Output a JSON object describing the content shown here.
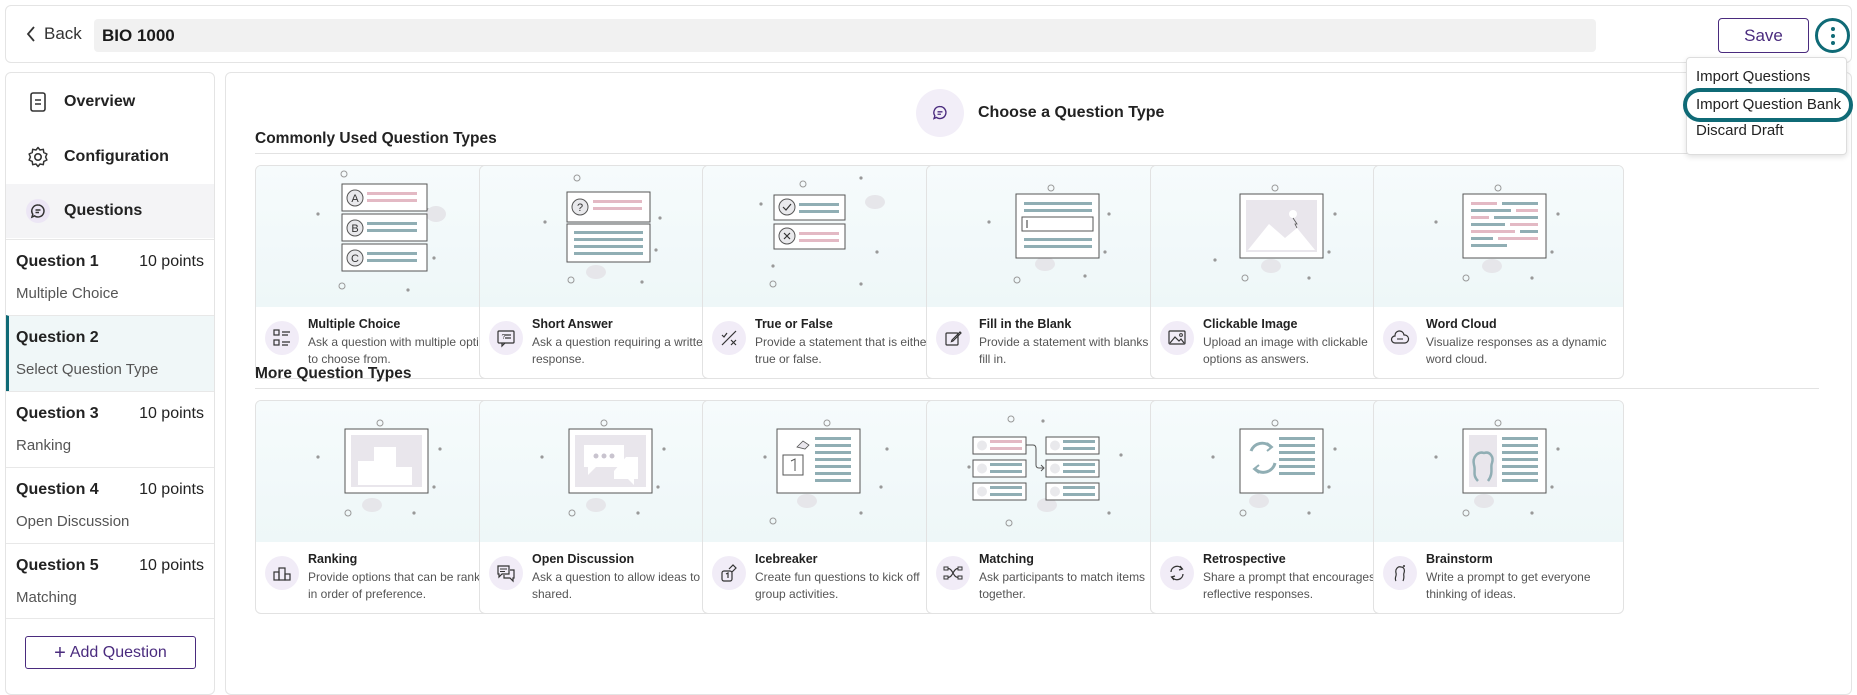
{
  "header": {
    "back_label": "Back",
    "title": "BIO 1000",
    "save_label": "Save"
  },
  "menu": {
    "items": [
      "Import Questions",
      "Import Question Bank",
      "Discard Draft"
    ]
  },
  "sidebar": {
    "nav": [
      {
        "label": "Overview",
        "icon": "document-icon"
      },
      {
        "label": "Configuration",
        "icon": "gear-icon"
      },
      {
        "label": "Questions",
        "icon": "chat-icon"
      }
    ],
    "questions": [
      {
        "title": "Question 1",
        "points": "10 points",
        "type": "Multiple Choice"
      },
      {
        "title": "Question 2",
        "points": "",
        "type": "Select Question Type"
      },
      {
        "title": "Question 3",
        "points": "10 points",
        "type": "Ranking"
      },
      {
        "title": "Question 4",
        "points": "10 points",
        "type": "Open Discussion"
      },
      {
        "title": "Question 5",
        "points": "10 points",
        "type": "Matching"
      }
    ],
    "add_label": "Add Question"
  },
  "main": {
    "heading": "Choose a Question Type",
    "common_title": "Commonly Used Question Types",
    "more_title": "More Question Types",
    "common": [
      {
        "title": "Multiple Choice",
        "desc": "Ask a question with multiple options to choose from.",
        "icon": "checklist-icon"
      },
      {
        "title": "Short Answer",
        "desc": "Ask a question requiring a written response.",
        "icon": "short-answer-icon"
      },
      {
        "title": "True or False",
        "desc": "Provide a statement that is either true or false.",
        "icon": "true-false-icon"
      },
      {
        "title": "Fill in the Blank",
        "desc": "Provide a statement with blanks to fill in.",
        "icon": "edit-icon"
      },
      {
        "title": "Clickable Image",
        "desc": "Upload an image with clickable options as answers.",
        "icon": "image-icon"
      },
      {
        "title": "Word Cloud",
        "desc": "Visualize responses as a dynamic word cloud.",
        "icon": "cloud-icon"
      }
    ],
    "more": [
      {
        "title": "Ranking",
        "desc": "Provide options that can be ranked in order of preference.",
        "icon": "podium-icon"
      },
      {
        "title": "Open Discussion",
        "desc": "Ask a question to allow ideas to be shared.",
        "icon": "discussion-icon"
      },
      {
        "title": "Icebreaker",
        "desc": "Create fun questions to kick off group activities.",
        "icon": "icebreaker-icon"
      },
      {
        "title": "Matching",
        "desc": "Ask participants to match items together.",
        "icon": "shuffle-icon"
      },
      {
        "title": "Retrospective",
        "desc": "Share a prompt that encourages reflective responses.",
        "icon": "cycle-icon"
      },
      {
        "title": "Brainstorm",
        "desc": "Write a prompt to get everyone thinking of ideas.",
        "icon": "brainstorm-icon"
      }
    ],
    "illus_letters": [
      "A",
      "B",
      "C"
    ],
    "illus_question_mark": "?"
  },
  "colors": {
    "accent": "#4a2b7e",
    "focus": "#0f6a76",
    "tint": "#f1ecf7"
  }
}
